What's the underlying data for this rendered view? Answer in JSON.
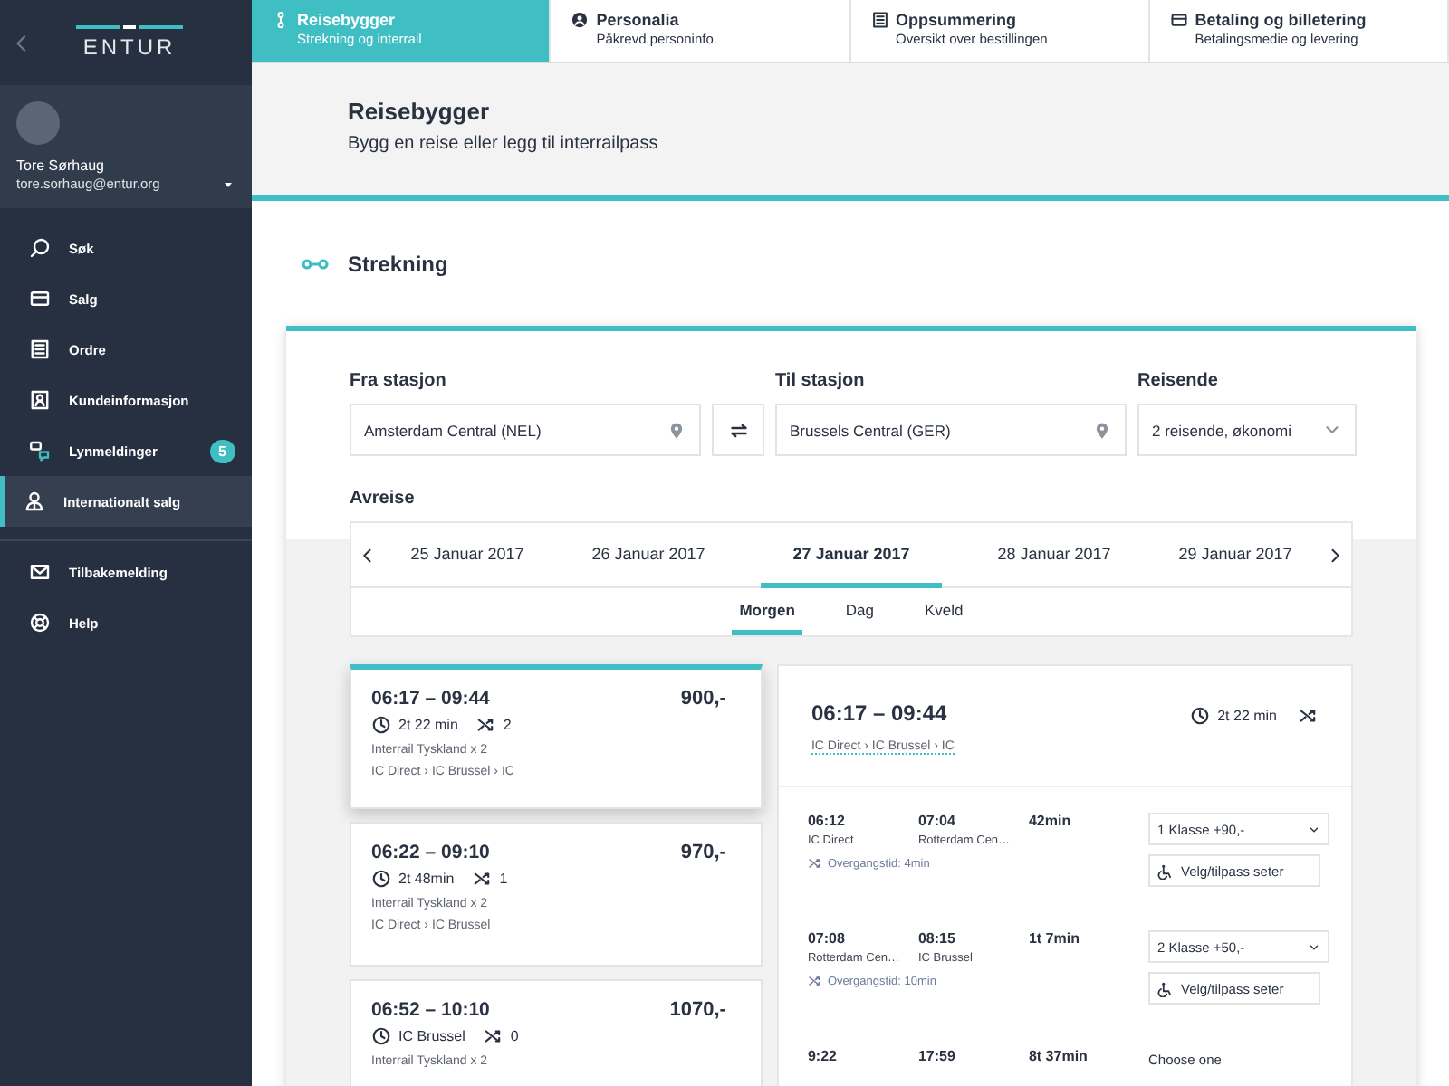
{
  "sidebar": {
    "logo": "ENTUR",
    "user": {
      "name": "Tore Sørhaug",
      "email": "tore.sorhaug@entur.org"
    },
    "items": [
      {
        "label": "Søk",
        "selected": false
      },
      {
        "label": "Salg",
        "selected": false
      },
      {
        "label": "Ordre",
        "selected": false
      },
      {
        "label": "Kundeinformasjon",
        "selected": false
      },
      {
        "label": "Lynmeldinger",
        "selected": false,
        "badge": "5"
      },
      {
        "label": "Internationalt salg",
        "selected": true
      }
    ],
    "bottom_items": [
      {
        "label": "Tilbakemelding",
        "selected": false
      },
      {
        "label": "Help",
        "selected": false
      }
    ]
  },
  "steps": [
    {
      "title": "Reisebygger",
      "subtitle": "Strekning og interrail",
      "selected": true
    },
    {
      "title": "Personalia",
      "subtitle": "Påkrevd personinfo.",
      "selected": false
    },
    {
      "title": "Oppsummering",
      "subtitle": "Oversikt over bestillingen",
      "selected": false
    },
    {
      "title": "Betaling og billetering",
      "subtitle": "Betalingsmedie og levering",
      "selected": false
    }
  ],
  "header": {
    "title": "Reisebygger",
    "subtitle": "Bygg en reise eller legg til interrailpass"
  },
  "section": {
    "title": "Strekning"
  },
  "form": {
    "from": {
      "label": "Fra stasjon",
      "value": "Amsterdam Central (NEL)"
    },
    "to": {
      "label": "Til stasjon",
      "value": "Brussels Central (GER)"
    },
    "travelers": {
      "label": "Reisende",
      "value": "2 reisende, økonomi"
    },
    "departure_label": "Avreise"
  },
  "dates": [
    {
      "label": "25 Januar 2017",
      "selected": false
    },
    {
      "label": "26 Januar 2017",
      "selected": false
    },
    {
      "label": "27 Januar 2017",
      "selected": true
    },
    {
      "label": "28 Januar 2017",
      "selected": false
    },
    {
      "label": "29 Januar 2017",
      "selected": false
    }
  ],
  "periods": [
    {
      "label": "Morgen",
      "selected": true
    },
    {
      "label": "Dag",
      "selected": false
    },
    {
      "label": "Kveld",
      "selected": false
    }
  ],
  "results": [
    {
      "time": "06:17 – 09:44",
      "price": "900,-",
      "duration": "2t 22 min",
      "changes": "2",
      "ticket": "Interrail Tyskland x 2",
      "route": "IC Direct › IC Brussel › IC",
      "selected": true
    },
    {
      "time": "06:22 – 09:10",
      "price": "970,-",
      "duration": "2t 48min",
      "changes": "1",
      "ticket": "Interrail Tyskland x 2",
      "route": "IC Direct › IC Brussel",
      "selected": false
    },
    {
      "time": "06:52 – 10:10",
      "price": "1070,-",
      "duration": "IC Brussel",
      "changes": "0",
      "ticket": "Interrail Tyskland x 2",
      "selected": false
    }
  ],
  "detail": {
    "time": "06:17 – 09:44",
    "route": "IC Direct › IC Brussel › IC",
    "duration": "2t 22 min",
    "legs": [
      {
        "departure": "06:12",
        "departure_station": "IC Direct",
        "arrival": "07:04",
        "arrival_station": "Rotterdam Cen…",
        "duration": "42min",
        "transfer": "Overgangstid: 4min",
        "class": "1 Klasse +90,-",
        "seat_button": "Velg/tilpass seter"
      },
      {
        "departure": "07:08",
        "departure_station": "Rotterdam Cen…",
        "arrival": "08:15",
        "arrival_station": "IC Brussel",
        "duration": "1t 7min",
        "transfer": "Overgangstid: 10min",
        "class": "2 Klasse +50,-",
        "seat_button": "Velg/tilpass seter"
      },
      {
        "departure": "9:22",
        "arrival": "17:59",
        "duration": "8t 37min",
        "prompt": "Choose one"
      }
    ]
  }
}
